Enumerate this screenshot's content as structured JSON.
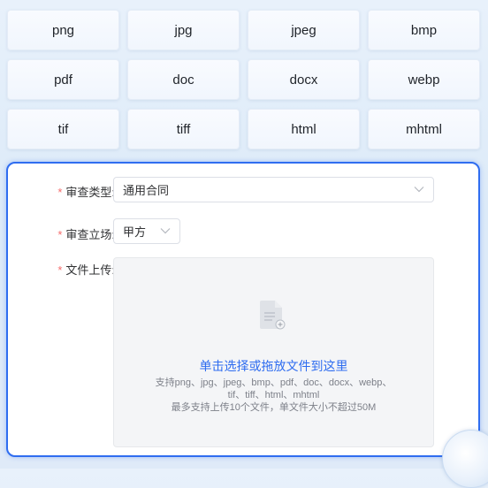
{
  "formats": [
    "png",
    "jpg",
    "jpeg",
    "bmp",
    "pdf",
    "doc",
    "docx",
    "webp",
    "tif",
    "tiff",
    "html",
    "mhtml"
  ],
  "form": {
    "review_type": {
      "required_mark": "*",
      "label": "审查类型:",
      "value": "通用合同"
    },
    "review_stance": {
      "required_mark": "*",
      "label": "审查立场:",
      "value": "甲方"
    },
    "file_upload": {
      "required_mark": "*",
      "label": "文件上传:",
      "main_text": "单击选择或拖放文件到这里",
      "hint_line1": "支持png、jpg、jpeg、bmp、pdf、doc、docx、webp、",
      "hint_line2": "tif、tiff、html、mhtml",
      "hint_line3": "最多支持上传10个文件，单文件大小不超过50M"
    }
  },
  "colors": {
    "accent": "#2f6df0",
    "required": "#f56c6c",
    "hint": "#7d8089"
  },
  "icons": {
    "select_arrow": "chevron-down-icon",
    "upload": "document-add-icon"
  }
}
